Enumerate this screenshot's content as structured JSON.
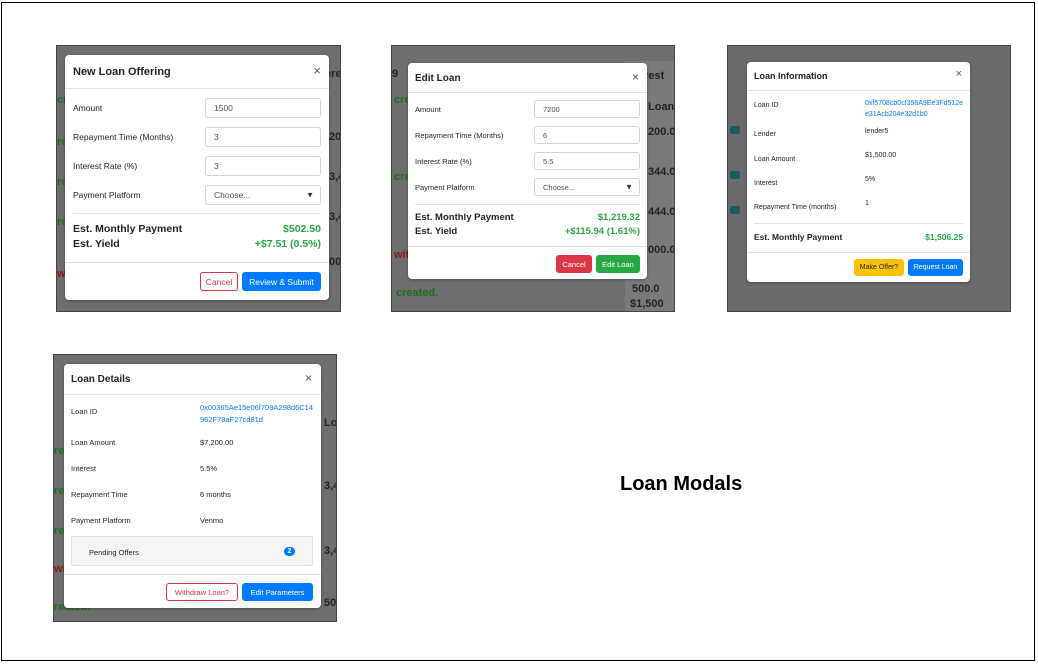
{
  "caption": "Loan Modals",
  "colors": {
    "primary": "#007bff",
    "success": "#28a745",
    "danger": "#dc3545",
    "warning": "#ffc107"
  },
  "new_loan": {
    "title": "New Loan Offering",
    "close": "×",
    "fields": [
      {
        "label": "Amount",
        "value": "1500"
      },
      {
        "label": "Repayment Time (Months)",
        "value": "3"
      },
      {
        "label": "Interest Rate (%)",
        "value": "3"
      }
    ],
    "platform_label": "Payment Platform",
    "platform_value": "Choose...",
    "monthly_label": "Est. Monthly Payment",
    "monthly_value": "$502.50",
    "yield_label": "Est. Yield",
    "yield_value": "+$7.51 (0.5%)",
    "cancel": "Cancel",
    "submit": "Review & Submit"
  },
  "edit_loan": {
    "title": "Edit Loan",
    "close": "×",
    "fields": [
      {
        "label": "Amount",
        "value": "7200"
      },
      {
        "label": "Repayment Time (Months)",
        "value": "6"
      },
      {
        "label": "Interest Rate (%)",
        "value": "5.5"
      }
    ],
    "platform_label": "Payment Platform",
    "platform_value": "Choose...",
    "monthly_label": "Est. Monthly Payment",
    "monthly_value": "$1,219.32",
    "yield_label": "Est. Yield",
    "yield_value": "+$115.94 (1.61%)",
    "cancel": "Cancel",
    "submit": "Edit Loan"
  },
  "loan_info": {
    "title": "Loan Information",
    "close": "×",
    "rows": [
      {
        "label": "Loan ID",
        "value": "0xf5708cb0cf358A9Ee3Fd512ee31Acb204e32d1b0",
        "link": true
      },
      {
        "label": "Lender",
        "value": "lender5"
      },
      {
        "label": "Loan Amount",
        "value": "$1,500.00"
      },
      {
        "label": "Interest",
        "value": "5%"
      },
      {
        "label": "Repayment Time (months)",
        "value": "1"
      }
    ],
    "monthly_label": "Est. Monthly Payment",
    "monthly_value": "$1,506.25",
    "offer": "Make Offer?",
    "request": "Request Loan"
  },
  "loan_details": {
    "title": "Loan Details",
    "close": "×",
    "rows": [
      {
        "label": "Loan ID",
        "value": "0x00365Ae15e06f709A298d6C14962F78aF27cd81d",
        "link": true
      },
      {
        "label": "Loan Amount",
        "value": "$7,200.00"
      },
      {
        "label": "Interest",
        "value": "5.5%"
      },
      {
        "label": "Repayment Time",
        "value": "6 months"
      },
      {
        "label": "Payment Platform",
        "value": "Venmo"
      }
    ],
    "offers_label": "Pending Offers",
    "offers_count": "2",
    "withdraw": "Withdraw Loan?",
    "edit": "Edit Parameters"
  },
  "background": {
    "s1": [
      "cre",
      "re",
      "re",
      "re",
      "re",
      "wi",
      "ere",
      "L",
      "200",
      "3,4",
      "3,4",
      "00"
    ],
    "s2": [
      "9",
      "cre",
      "cre",
      "wit",
      "created.",
      "erest R",
      "Loans",
      "200.0",
      "344.0",
      "444.0",
      "000.0",
      "500.0",
      "$1,500"
    ],
    "s4": [
      "cre",
      "re",
      "re",
      "re",
      "re",
      "wi",
      "reated.",
      "ere",
      "Lo",
      "3,4",
      "3,4",
      "500"
    ]
  }
}
